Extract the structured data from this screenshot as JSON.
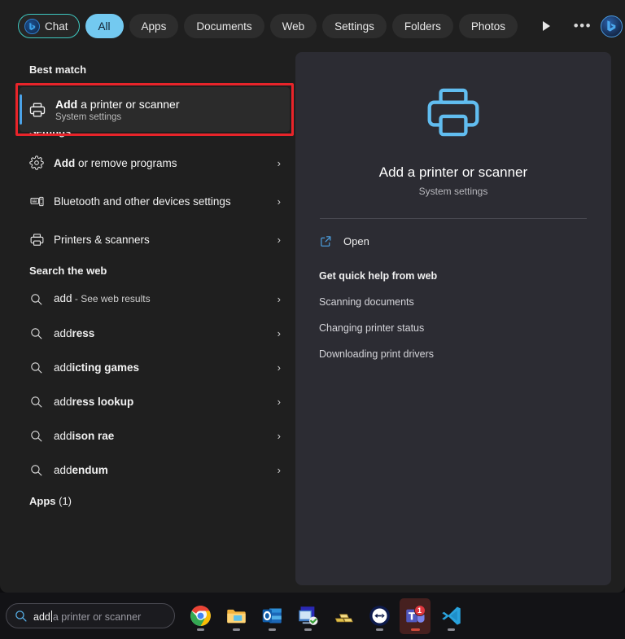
{
  "filter_bar": {
    "chat_pill": "Chat",
    "pills": [
      "All",
      "Apps",
      "Documents",
      "Web",
      "Settings",
      "Folders",
      "Photos"
    ],
    "active_pill": "All",
    "more_arrow_icon": "play-arrow-icon",
    "overflow_icon": "ellipsis-icon",
    "bing_icon": "bing-chat-icon"
  },
  "results": {
    "best_match": {
      "heading": "Best match",
      "title_bold": "Add",
      "title_rest": " a printer or scanner",
      "subtitle": "System settings",
      "icon": "printer-icon",
      "highlight_color": "#e8242a",
      "accent_color": "#4ca3e8"
    },
    "settings": {
      "heading": "Settings",
      "items": [
        {
          "icon": "gear-icon",
          "bold": "Add",
          "rest": " or remove programs",
          "chevron": "›"
        },
        {
          "icon": "devices-icon",
          "bold": "",
          "rest": "Bluetooth and other devices settings",
          "chevron": "›"
        },
        {
          "icon": "printer-icon",
          "bold": "",
          "rest": "Printers & scanners",
          "chevron": "›"
        }
      ]
    },
    "web": {
      "heading": "Search the web",
      "items": [
        {
          "icon": "search-icon",
          "normal": "add",
          "bold": "",
          "suffix": " - See web results",
          "chevron": "›"
        },
        {
          "icon": "search-icon",
          "normal": "add",
          "bold": "ress",
          "suffix": "",
          "chevron": "›"
        },
        {
          "icon": "search-icon",
          "normal": "add",
          "bold": "icting games",
          "suffix": "",
          "chevron": "›"
        },
        {
          "icon": "search-icon",
          "normal": "add",
          "bold": "ress lookup",
          "suffix": "",
          "chevron": "›"
        },
        {
          "icon": "search-icon",
          "normal": "add",
          "bold": "ison rae",
          "suffix": "",
          "chevron": "›"
        },
        {
          "icon": "search-icon",
          "normal": "add",
          "bold": "endum",
          "suffix": "",
          "chevron": "›"
        }
      ]
    },
    "apps": {
      "heading_bold": "Apps",
      "heading_count": " (1)"
    }
  },
  "preview": {
    "icon": "printer-large-icon",
    "icon_color": "#61bdf0",
    "title": "Add a printer or scanner",
    "subtitle": "System settings",
    "open_label": "Open",
    "open_icon": "external-link-icon",
    "help_heading": "Get quick help from web",
    "help_links": [
      "Scanning documents",
      "Changing printer status",
      "Downloading print drivers"
    ]
  },
  "taskbar": {
    "search": {
      "icon": "search-icon",
      "typed_value": "add",
      "ghost_suggestion": " a printer or scanner"
    },
    "apps": [
      {
        "name": "chrome-icon",
        "label": "Google Chrome",
        "running": true,
        "badge": ""
      },
      {
        "name": "file-explorer-icon",
        "label": "File Explorer",
        "running": true,
        "badge": ""
      },
      {
        "name": "outlook-icon",
        "label": "Outlook",
        "running": true,
        "badge": ""
      },
      {
        "name": "remote-desktop-icon",
        "label": "Remote Desktop",
        "running": true,
        "badge": ""
      },
      {
        "name": "gold-bars-icon",
        "label": "Gold",
        "running": false,
        "badge": ""
      },
      {
        "name": "teamviewer-icon",
        "label": "TeamViewer",
        "running": true,
        "badge": ""
      },
      {
        "name": "teams-icon",
        "label": "Microsoft Teams",
        "running": true,
        "badge": "1"
      },
      {
        "name": "vscode-icon",
        "label": "Visual Studio Code",
        "running": true,
        "badge": ""
      }
    ]
  }
}
